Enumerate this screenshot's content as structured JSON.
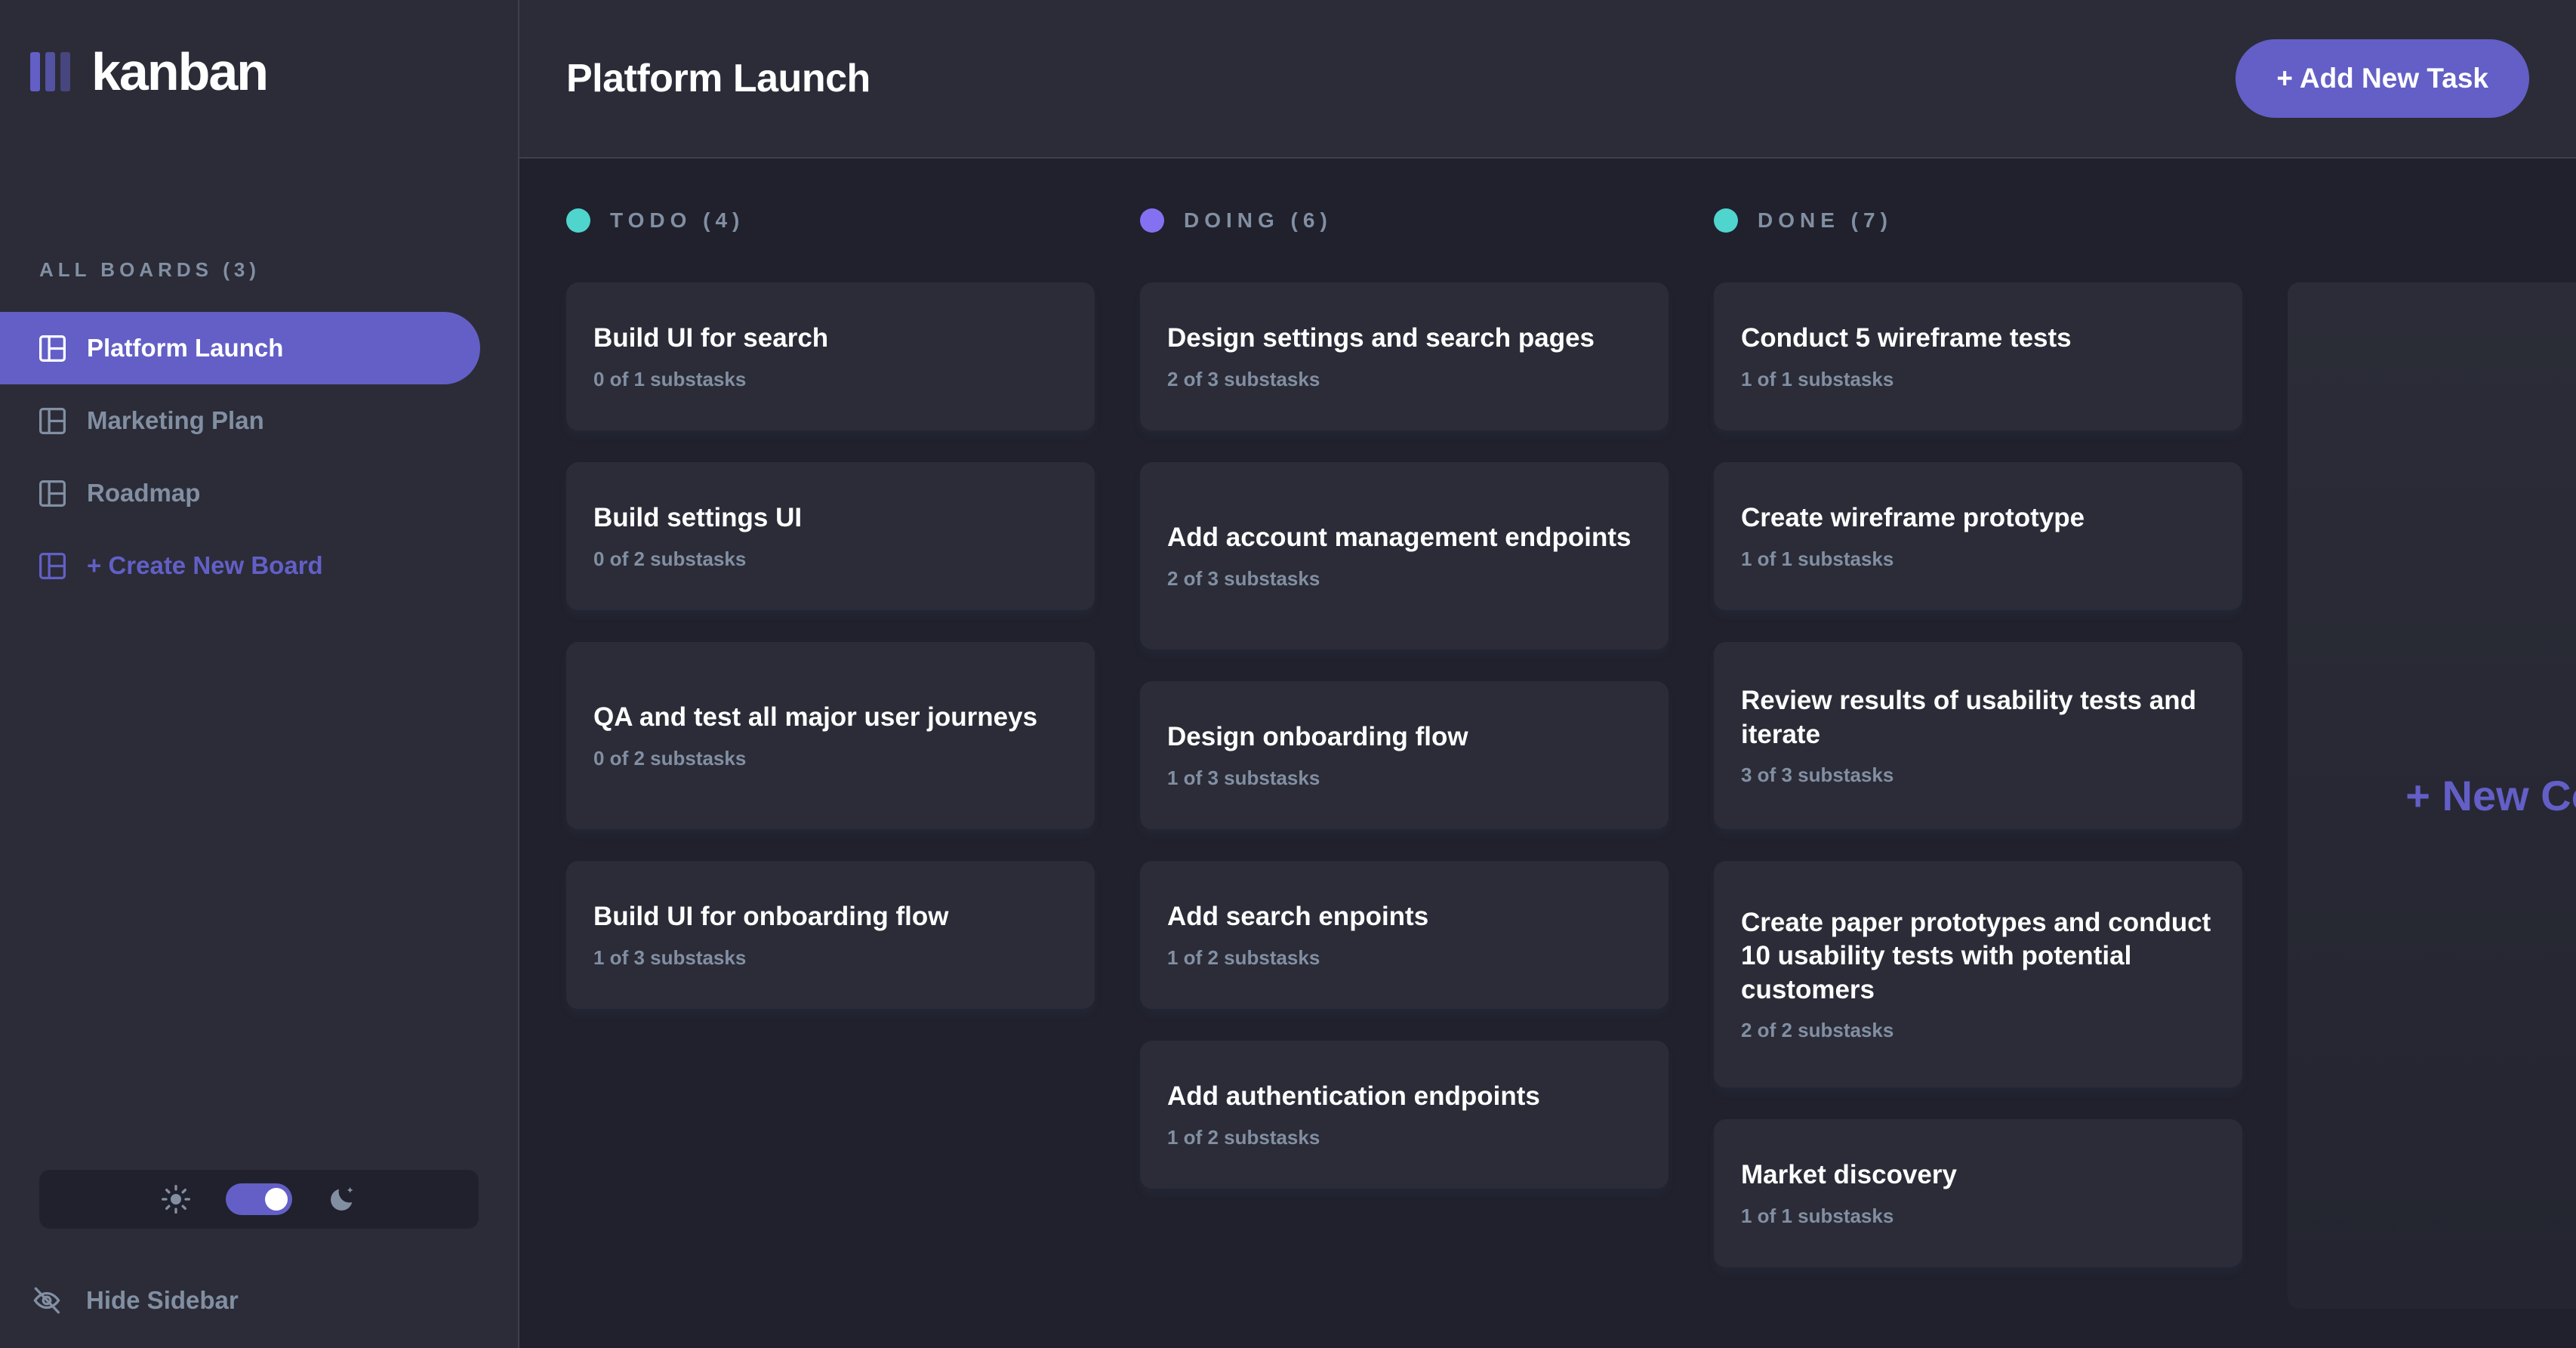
{
  "app": {
    "logo_text": "kanban",
    "accent_color": "#635FC7",
    "sidebar_bg": "#2B2C37",
    "board_bg": "#20212C",
    "card_bg": "#2B2C37",
    "muted_text_color": "#828FA3"
  },
  "sidebar": {
    "boards_heading": "ALL BOARDS (3)",
    "boards": [
      {
        "label": "Platform Launch",
        "active": true
      },
      {
        "label": "Marketing Plan",
        "active": false
      },
      {
        "label": "Roadmap",
        "active": false
      }
    ],
    "create_board_label": "+ Create New Board",
    "theme_toggle": {
      "light_icon": "sun-icon",
      "dark_icon": "moon-icon",
      "state": "dark"
    },
    "hide_sidebar_label": "Hide Sidebar",
    "hide_sidebar_icon": "eye-off-icon"
  },
  "header": {
    "title": "Platform Launch",
    "add_task_label": "+ Add New Task"
  },
  "board": {
    "new_column_label": "+ New Column",
    "columns": [
      {
        "name": "TODO (4)",
        "dot_color": "#49C4E5",
        "tasks": [
          {
            "title": "Build UI for search",
            "subtasks": "0 of 1 substasks",
            "lines": 1
          },
          {
            "title": "Build settings UI",
            "subtasks": "0 of 2 substasks",
            "lines": 1
          },
          {
            "title": "QA and test all major user journeys",
            "subtasks": "0 of 2 substasks",
            "lines": 2
          },
          {
            "title": "Build UI for onboarding flow",
            "subtasks": "1 of 3 substasks",
            "lines": 1
          }
        ]
      },
      {
        "name": "DOING (6)",
        "dot_color": "#8471F2",
        "tasks": [
          {
            "title": "Design settings and search pages",
            "subtasks": "2 of 3 substasks",
            "lines": 1
          },
          {
            "title": "Add account management endpoints",
            "subtasks": "2 of 3 substasks",
            "lines": 2
          },
          {
            "title": "Design onboarding flow",
            "subtasks": "1 of 3 substasks",
            "lines": 1
          },
          {
            "title": "Add search enpoints",
            "subtasks": "1 of 2 substasks",
            "lines": 1
          },
          {
            "title": "Add authentication endpoints",
            "subtasks": "1 of 2 substasks",
            "lines": 1
          }
        ]
      },
      {
        "name": "DONE (7)",
        "dot_color": "#4FD4CE",
        "tasks": [
          {
            "title": "Conduct 5 wireframe tests",
            "subtasks": "1 of 1 substasks",
            "lines": 1
          },
          {
            "title": "Create wireframe prototype",
            "subtasks": "1 of 1 substasks",
            "lines": 1
          },
          {
            "title": "Review results of usability tests and iterate",
            "subtasks": "3 of 3 substasks",
            "lines": 2
          },
          {
            "title": "Create paper prototypes and conduct 10 usability tests with potential customers",
            "subtasks": "2 of 2 substasks",
            "lines": 3
          },
          {
            "title": "Market discovery",
            "subtasks": "1 of 1 substasks",
            "lines": 1
          }
        ]
      }
    ]
  }
}
